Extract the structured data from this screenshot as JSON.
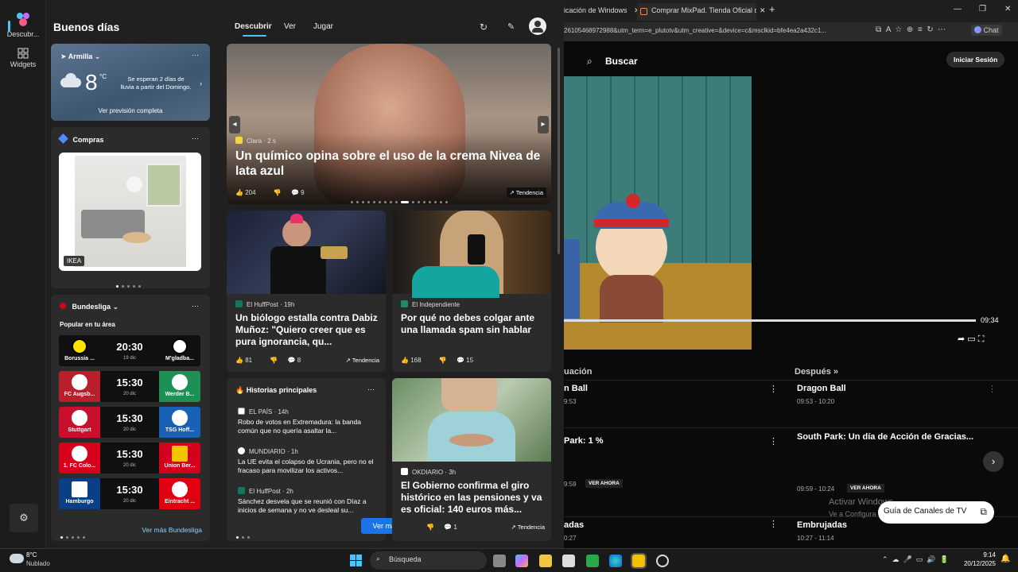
{
  "rail": {
    "descubrir_label": "Descubr...",
    "widgets_label": "Widgets"
  },
  "header": {
    "greeting": "Buenos días",
    "tabs": [
      "Descubrir",
      "Ver",
      "Jugar"
    ]
  },
  "weather": {
    "location": "Armilla",
    "temp": "8",
    "unit": "°C",
    "forecast_line1": "Se esperan 2 días de",
    "forecast_line2": "lluvia a partir del Domingo.",
    "link": "Ver previsión completa"
  },
  "shopping": {
    "title": "Compras",
    "brand": "IKEA"
  },
  "bundesliga": {
    "title": "Bundesliga",
    "subtitle": "Popular en tu área",
    "more": "Ver más Bundesliga",
    "matches": [
      {
        "home": "Borussia ...",
        "time": "20:30",
        "date": "19 dic",
        "away": "M'gladba..."
      },
      {
        "home": "FC Augsb...",
        "time": "15:30",
        "date": "20 dic",
        "away": "Werder B..."
      },
      {
        "home": "Stuttgart",
        "time": "15:30",
        "date": "20 dic",
        "away": "TSG Hoff..."
      },
      {
        "home": "1. FC Colo...",
        "time": "15:30",
        "date": "20 dic",
        "away": "Union Ber..."
      },
      {
        "home": "Hamburgo",
        "time": "15:30",
        "date": "20 dic",
        "away": "Eintracht ..."
      }
    ]
  },
  "hero": {
    "source": "Clara",
    "age": "2 s",
    "title": "Un químico opina sobre el uso de la crema Nivea de lata azul",
    "likes": "204",
    "comments": "9",
    "badge": "Tendencia"
  },
  "news1": {
    "source": "El HuffPost",
    "age": "19h",
    "title": "Un biólogo estalla contra Dabiz Muñoz: \"Quiero creer que es pura ignorancia, qu...",
    "likes": "81",
    "comments": "8",
    "badge": "Tendencia"
  },
  "news2": {
    "source": "El Independiente",
    "title": "Por qué no debes colgar ante una llamada spam sin hablar",
    "likes": "168",
    "comments": "15"
  },
  "top_stories": {
    "title": "Historias principales",
    "items": [
      {
        "source": "EL PAÍS",
        "age": "14h",
        "text": "Robo de votos en Extremadura: la banda común que no quería asaltar la..."
      },
      {
        "source": "MUNDIARIO",
        "age": "1h",
        "text": "La UE evita el colapso de Ucrania, pero no el fracaso para movilizar los activos..."
      },
      {
        "source": "El HuffPost",
        "age": "2h",
        "text": "Sánchez desvela que se reunió con Díaz a inicios de semana y no ve desleal su..."
      }
    ],
    "more": "Ver más"
  },
  "news3": {
    "source": "OKDIARIO",
    "age": "3h",
    "title": "El Gobierno confirma el giro histórico en las pensiones y va es oficial: 140 euros más...",
    "comments": "1",
    "badge": "Tendencia"
  },
  "browser": {
    "tabs": [
      "icación de Windows",
      "Comprar MixPad. Tienda Oficial de"
    ],
    "url": "26105468972988&utm_term=e_plutotv&utm_creative=&device=c&msclkid=bfe4ea2a432c1...",
    "chat": "Chat",
    "search": "Buscar",
    "login": "Iniciar Sesión",
    "player_time": "09:34",
    "now_label": "uación",
    "next_label": "Después",
    "rows": [
      {
        "now_title": "n Ball",
        "now_time": "9:53",
        "next_title": "Dragon Ball",
        "next_time": "09:53 - 10:20"
      },
      {
        "now_title": "Park: 1 %",
        "now_time": "9:59",
        "now_badge": "VER AHORA",
        "next_title": "South Park: Un día de Acción de Gracias...",
        "next_time": "09:59 - 10:24",
        "next_badge": "VER AHORA"
      },
      {
        "now_title": "adas",
        "now_time": "0:27",
        "next_title": "Embrujadas",
        "next_time": "10:27 - 11:14"
      }
    ],
    "activate_line1": "Activar Windows",
    "activate_line2": "Ve a Configura",
    "guide_button": "Guía de Canales de TV"
  },
  "taskbar": {
    "weather_temp": "8°C",
    "weather_desc": "Nublado",
    "search": "Búsqueda",
    "time": "9:14",
    "date": "20/12/2025"
  }
}
